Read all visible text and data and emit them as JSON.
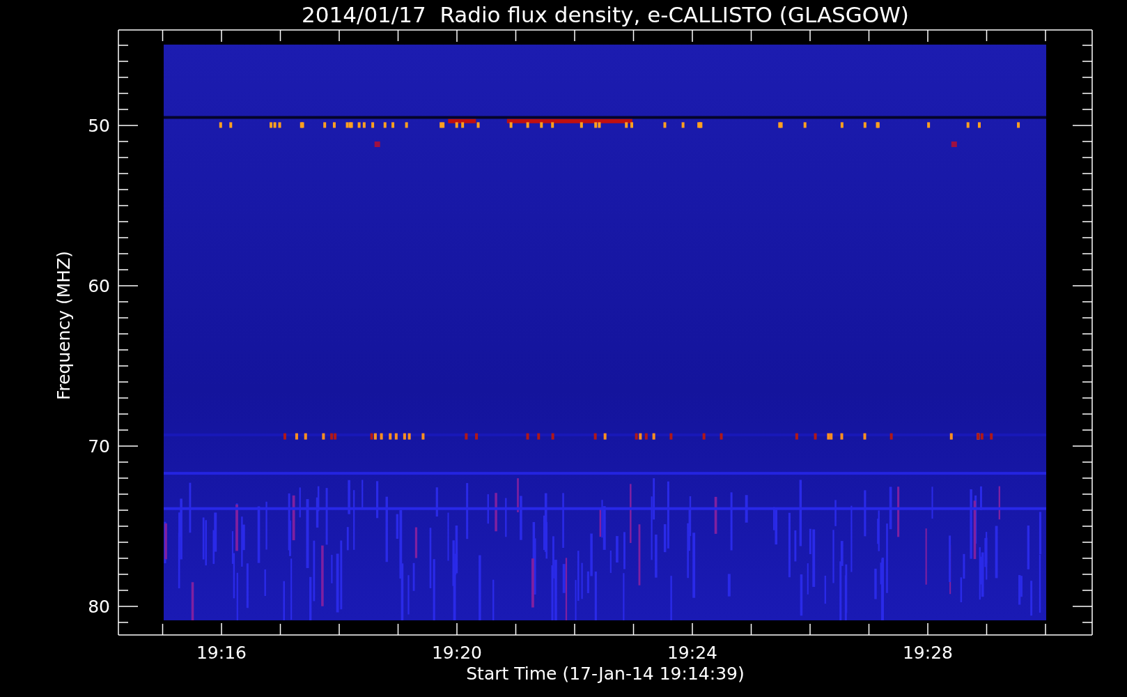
{
  "title": "2014/01/17  Radio flux density, e-CALLISTO (GLASGOW)",
  "y_axis": {
    "label": "Frequency (MHZ)",
    "ticks": [
      "50",
      "60",
      "70",
      "80"
    ]
  },
  "x_axis": {
    "label": "Start Time (17-Jan-14 19:14:39)",
    "ticks": [
      "19:16",
      "19:20",
      "19:24",
      "19:28"
    ]
  }
}
